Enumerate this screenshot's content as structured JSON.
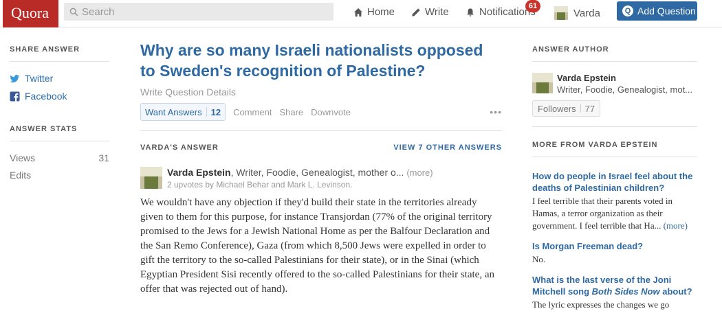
{
  "header": {
    "logo": "Quora",
    "search_placeholder": "Search",
    "nav": {
      "home": "Home",
      "write": "Write",
      "notifications": "Notifications",
      "notifications_count": "61",
      "user": "Varda"
    },
    "add_question": "Add Question"
  },
  "left": {
    "share_title": "SHARE ANSWER",
    "share_items": [
      "Twitter",
      "Facebook"
    ],
    "stats_title": "ANSWER STATS",
    "views_label": "Views",
    "views_value": "31",
    "edits_label": "Edits"
  },
  "question": {
    "title": "Why are so many Israeli nationalists opposed to Sweden's recognition of Palestine?",
    "details_link": "Write Question Details",
    "want_answers": "Want Answers",
    "want_count": "12",
    "comment": "Comment",
    "share": "Share",
    "downvote": "Downvote",
    "more": "•••"
  },
  "answer": {
    "label": "VARDA'S ANSWER",
    "view_other": "VIEW 7 OTHER ANSWERS",
    "author_name": "Varda Epstein",
    "author_desc": ", Writer, Foodie, Genealogist, mother o...",
    "author_more": "(more)",
    "upvotes": "2 upvotes by Michael Behar and Mark L. Levinson.",
    "body": "We wouldn't have any objection if they'd build their state in the territories already given to them for this purpose, for instance Transjordan (77% of the original territory promised to the Jews for a Jewish National Home as per the Balfour Declaration and the San Remo Conference), Gaza (from which 8,500 Jews were expelled in order to gift the territory to the so-called Palestinians for their state), or in the Sinai (which Egyptian President Sisi recently offered to the so-called Palestinians for their state, an offer that was rejected out of hand)."
  },
  "right": {
    "author_title": "ANSWER AUTHOR",
    "author_name": "Varda Epstein",
    "author_desc": "Writer, Foodie, Genealogist, mot...",
    "followers_label": "Followers",
    "followers_count": "77",
    "more_title": "MORE FROM VARDA EPSTEIN",
    "items": [
      {
        "q": "How do people in Israel feel about the deaths of Palestinian children?",
        "a": "I feel terrible that their parents voted in Hamas, a terror organization as their government. I feel terrible that Ha...",
        "more": "(more)"
      },
      {
        "q": "Is Morgan Freeman dead?",
        "a": "No."
      },
      {
        "q_pre": "What is the last verse of the Joni Mitchell song ",
        "q_italic": "Both Sides Now",
        "q_post": " about?",
        "a": "The lyric expresses the changes we go"
      }
    ]
  },
  "colors": {
    "brand": "#b92b27",
    "link": "#2e69a3",
    "badge": "#c9342d"
  }
}
